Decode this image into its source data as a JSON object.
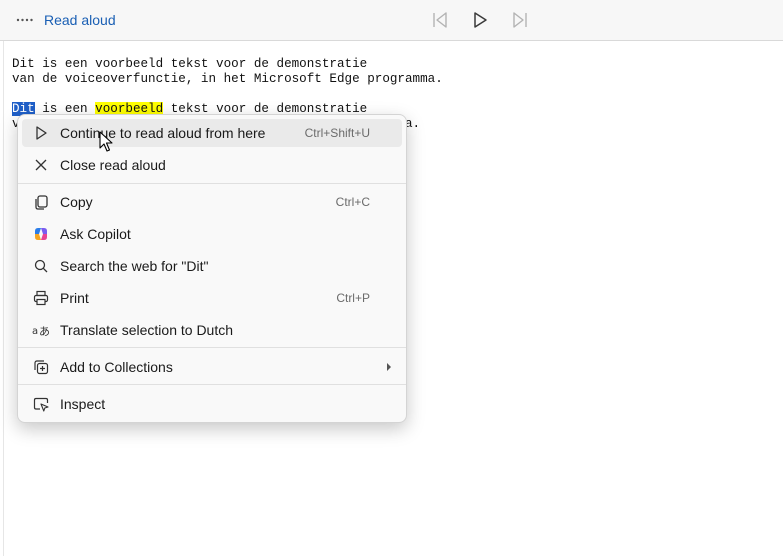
{
  "toolbar": {
    "title": "Read aloud",
    "icons": [
      "more-dots-icon",
      "previous-paragraph-icon",
      "play-icon",
      "next-paragraph-icon"
    ]
  },
  "document": {
    "line1": "Dit is een voorbeeld tekst voor de demonstratie",
    "line2": "van de voiceoverfunctie, in het Microsoft Edge programma.",
    "line3_selected": "Dit",
    "line3_mid": " is een ",
    "line3_highlight": "voorbeeld",
    "line3_rest": " tekst voor de demonstratie",
    "line4_start": "v",
    "line4_end": "a."
  },
  "menu": {
    "continue": {
      "label": "Continue to read aloud from here",
      "shortcut": "Ctrl+Shift+U"
    },
    "close": {
      "label": "Close read aloud"
    },
    "copy": {
      "label": "Copy",
      "shortcut": "Ctrl+C"
    },
    "copilot": {
      "label": "Ask Copilot"
    },
    "search": {
      "label": "Search the web for \"Dit\""
    },
    "print": {
      "label": "Print",
      "shortcut": "Ctrl+P"
    },
    "translate": {
      "label": "Translate selection to Dutch"
    },
    "collections": {
      "label": "Add to Collections"
    },
    "inspect": {
      "label": "Inspect"
    }
  },
  "colors": {
    "accent": "#1a5fb4",
    "selection": "#1f5fc8",
    "highlight": "#ffff00"
  }
}
